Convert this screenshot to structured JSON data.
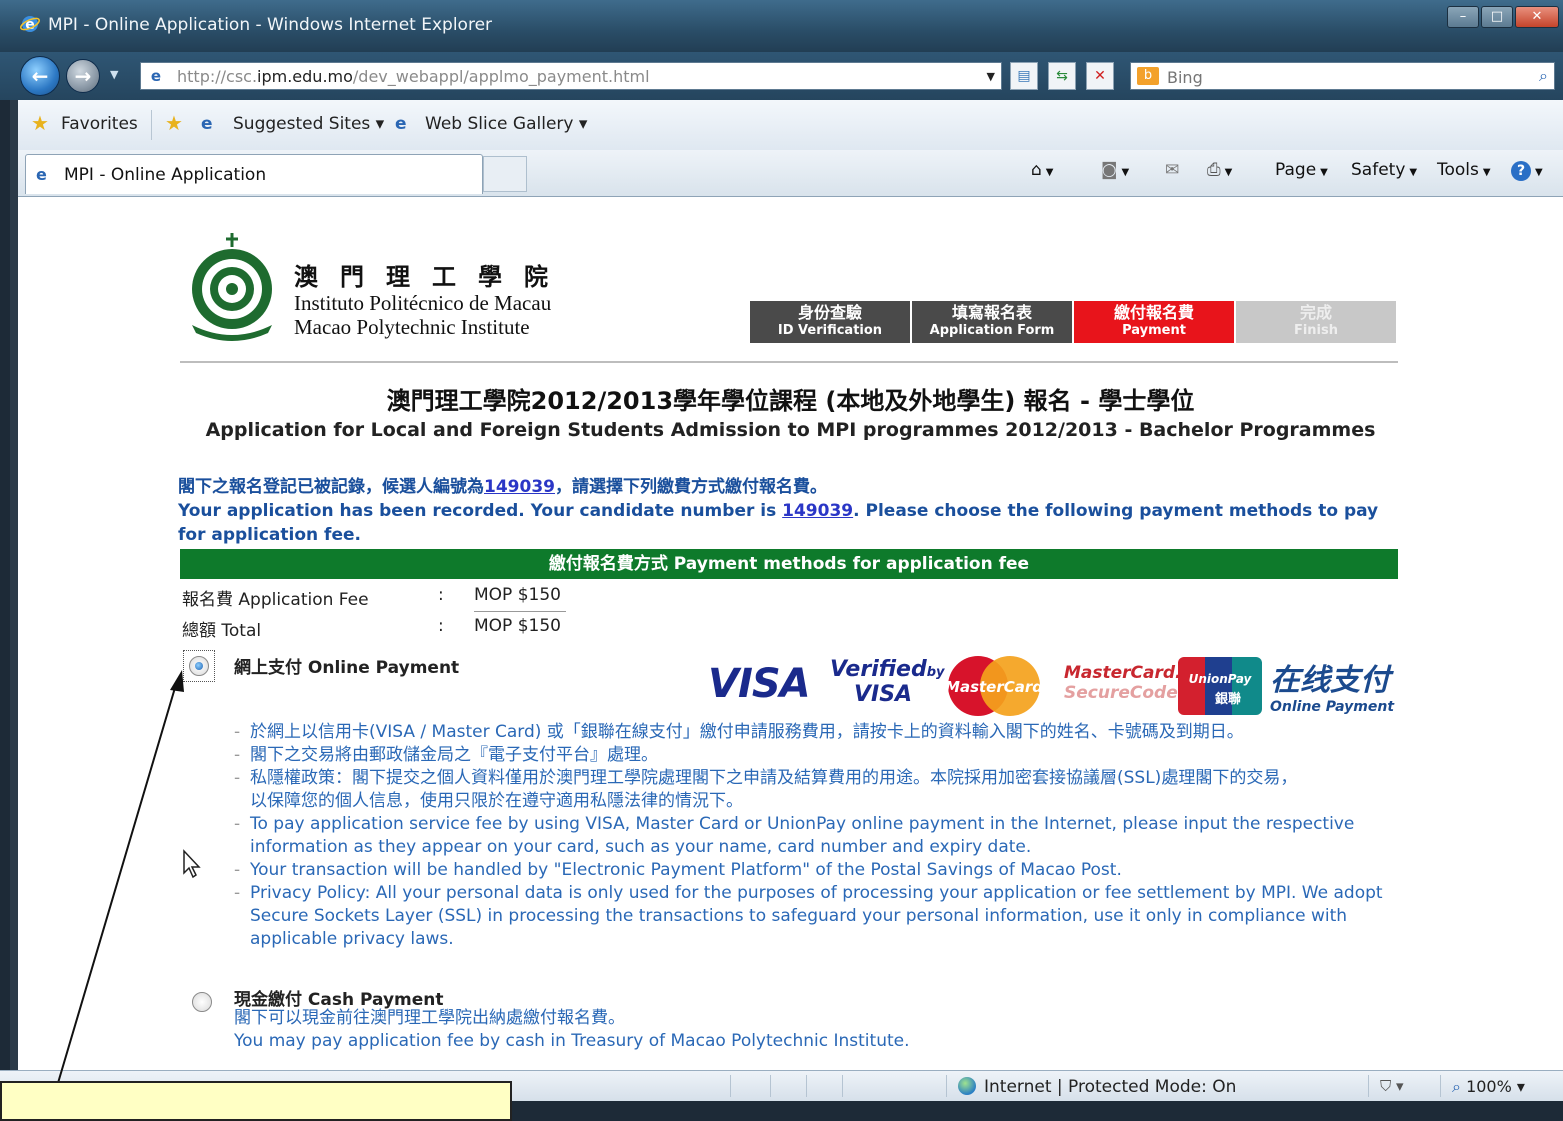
{
  "window": {
    "title": "MPI - Online Application - Windows Internet Explorer",
    "controls": {
      "minimize": "–",
      "maximize": "□",
      "close": "✕"
    }
  },
  "nav": {
    "url_prefix": "http://csc.",
    "url_domain": "ipm.edu.mo",
    "url_path": "/dev_webappl/applmo_payment.html",
    "search_placeholder": "Bing",
    "search_logo": "b"
  },
  "favorites": {
    "favorites_label": "Favorites",
    "suggested_sites": "Suggested Sites ▾",
    "web_slice_gallery": "Web Slice Gallery ▾"
  },
  "tab": {
    "title": "MPI - Online Application"
  },
  "command_bar": {
    "page": "Page",
    "safety": "Safety",
    "tools": "Tools",
    "help": "?"
  },
  "school": {
    "name_cn": "澳門理工學院",
    "name_pt": "Instituto Politécnico de Macau",
    "name_en": "Macao Polytechnic Institute"
  },
  "steps": [
    {
      "cn": "身份查驗",
      "en": "ID Verification",
      "state": "done"
    },
    {
      "cn": "填寫報名表",
      "en": "Application Form",
      "state": "done"
    },
    {
      "cn": "繳付報名費",
      "en": "Payment",
      "state": "active"
    },
    {
      "cn": "完成",
      "en": "Finish",
      "state": "future"
    }
  ],
  "heading": {
    "cn": "澳門理工學院2012/2013學年學位課程 (本地及外地學生) 報名 - 學士學位",
    "en": "Application for Local and Foreign Students Admission to MPI programmes 2012/2013 - Bachelor Programmes"
  },
  "notice": {
    "cn_before": "閣下之報名登記已被記錄，候選人編號為",
    "cn_after": "，請選擇下列繳費方式繳付報名費。",
    "en_before": "Your application has been recorded. Your candidate number is ",
    "en_after": ". Please choose the following payment methods to pay for application fee.",
    "candidate_number": "149039"
  },
  "payment_section": {
    "title": "繳付報名費方式 Payment methods for application fee",
    "fee_label": "報名費 Application Fee",
    "fee_value": "MOP $150",
    "total_label": "總額 Total",
    "total_value": "MOP $150",
    "colon": ":"
  },
  "online_payment": {
    "title": "網上支付 Online Payment",
    "selected": true,
    "logos": {
      "visa": "VISA",
      "verified_by": "Verified",
      "by": "by",
      "verified_visa": "VISA",
      "mastercard": "MasterCard",
      "mc_securecode_1": "MasterCard.",
      "mc_securecode_2": "SecureCode.",
      "unionpay_1": "UnionPay",
      "unionpay_2": "銀聯",
      "online_pay_zh": "在线支付",
      "online_pay_en": "Online Payment"
    },
    "lines": [
      "於網上以信用卡(VISA / Master Card) 或「銀聯在線支付」繳付申請服務費用，請按卡上的資料輸入閣下的姓名、卡號碼及到期日。",
      "閣下之交易將由郵政儲金局之『電子支付平台』處理。",
      "私隱權政策：閣下提交之個人資料僅用於澳門理工學院處理閣下之申請及結算費用的用途。本院採用加密套接協議層(SSL)處理閣下的交易，",
      "To pay application service fee by using VISA, Master Card or UnionPay online payment in the Internet, please input the respective",
      "Your transaction will be handled by \"Electronic Payment Platform\" of the Postal Savings of Macao Post.",
      "Privacy Policy: All your personal data is only used for the purposes of processing your application or fee settlement by MPI. We adopt"
    ],
    "continuations": [
      "以保障您的個人信息，使用只限於在遵守適用私隱法律的情況下。",
      "information as they appear on your card, such as your name, card number and expiry date.",
      "Secure Sockets Layer (SSL) in processing the transactions to safeguard your personal information, use it only in compliance with",
      "applicable privacy laws."
    ]
  },
  "cash_payment": {
    "title": "現金繳付 Cash Payment",
    "selected": false,
    "cn": "閣下可以現金前往澳門理工學院出納處繳付報名費。",
    "en": "You may pay application fee by cash in Treasury of Macao Polytechnic Institute."
  },
  "status_bar": {
    "zone": "Internet | Protected Mode: On",
    "zoom": "100%"
  },
  "colors": {
    "active_step": "#e8141b",
    "done_step": "#4a4a4a",
    "green_bar": "#0e7a2b",
    "link_blue": "#2a68b6",
    "callout_bg": "#ffffc4"
  }
}
